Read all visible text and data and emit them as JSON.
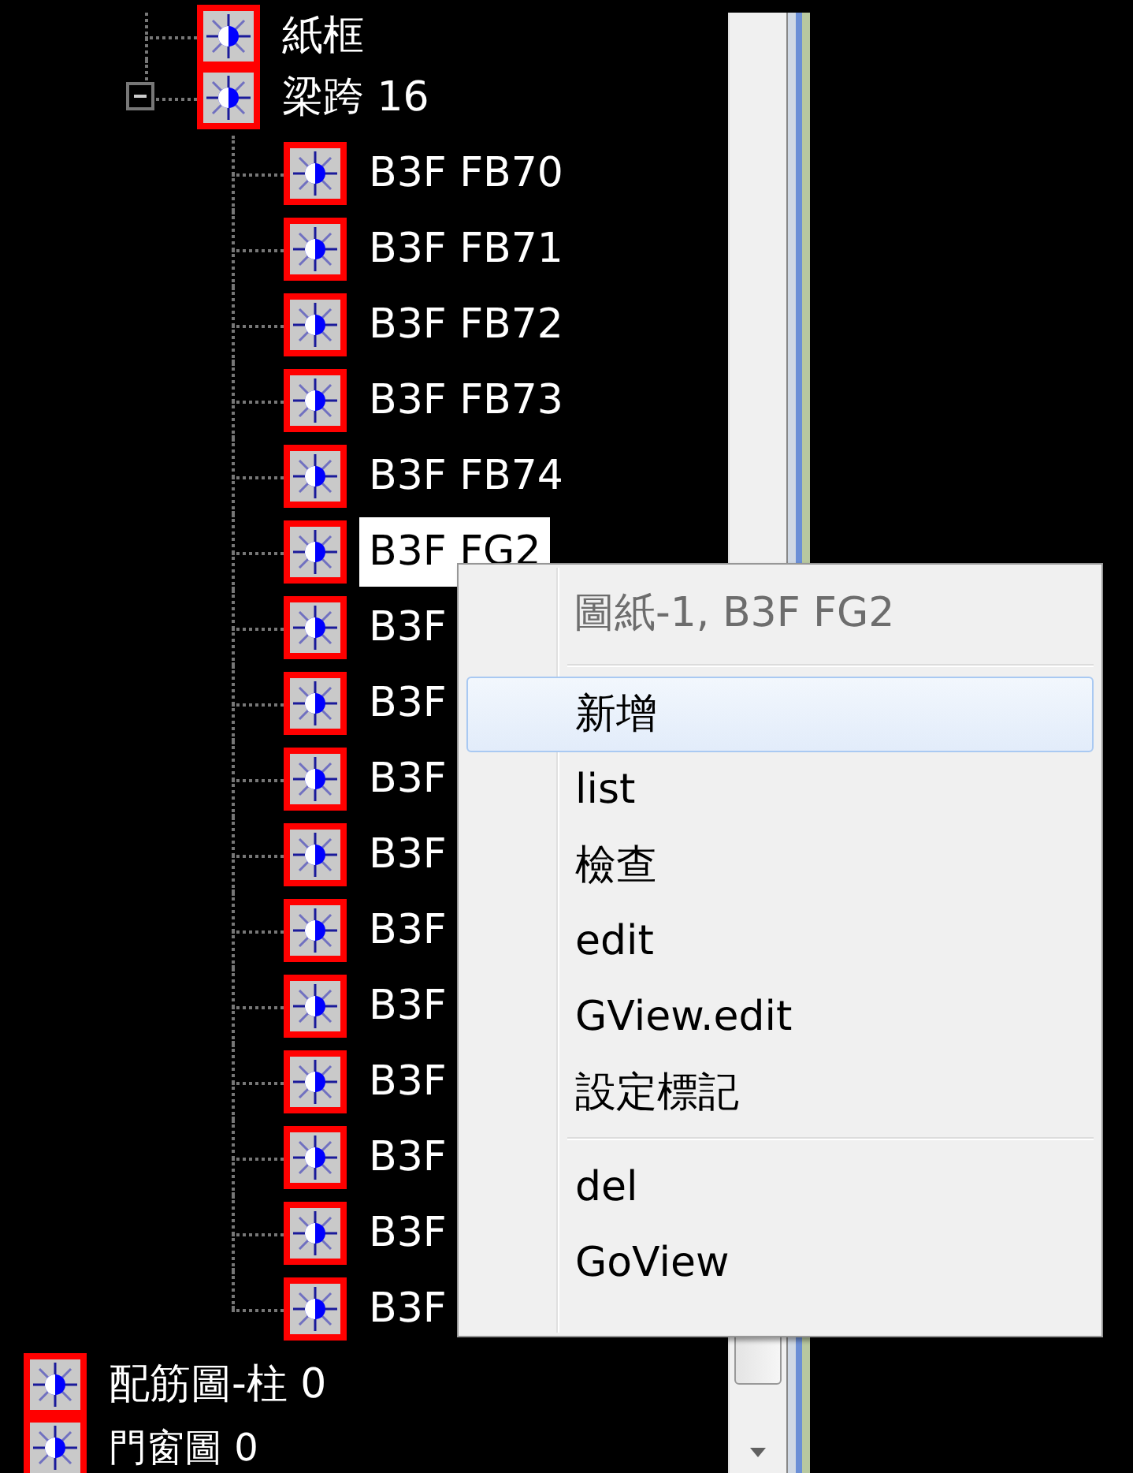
{
  "tree": {
    "nodes": [
      {
        "children": [
          {
            "children": [
              {
                "label": "紙框"
              },
              {
                "label": "梁跨 16",
                "expanded": true,
                "children": [
                  {
                    "label": "B3F FB70",
                    "selected": false
                  },
                  {
                    "label": "B3F FB71",
                    "selected": false
                  },
                  {
                    "label": "B3F FB72",
                    "selected": false
                  },
                  {
                    "label": "B3F FB73",
                    "selected": false
                  },
                  {
                    "label": "B3F FB74",
                    "selected": false
                  },
                  {
                    "label": "B3F FG2",
                    "selected": true
                  },
                  {
                    "label": "B3F",
                    "selected": false
                  },
                  {
                    "label": "B3F",
                    "selected": false
                  },
                  {
                    "label": "B3F",
                    "selected": false
                  },
                  {
                    "label": "B3F",
                    "selected": false
                  },
                  {
                    "label": "B3F",
                    "selected": false
                  },
                  {
                    "label": "B3F",
                    "selected": false
                  },
                  {
                    "label": "B3F",
                    "selected": false
                  },
                  {
                    "label": "B3F",
                    "selected": false
                  },
                  {
                    "label": "B3F",
                    "selected": false
                  },
                  {
                    "label": "B3F",
                    "selected": false
                  }
                ]
              }
            ]
          }
        ]
      },
      {
        "label": "配筋圖-柱 0"
      },
      {
        "label": "門窗圖 0"
      }
    ]
  },
  "context_menu": {
    "items": [
      {
        "kind": "header",
        "label": "圖紙-1, B3F FG2"
      },
      {
        "kind": "separator"
      },
      {
        "kind": "item",
        "label": "新增",
        "selected": true
      },
      {
        "kind": "item",
        "label": "list",
        "selected": false
      },
      {
        "kind": "item",
        "label": "檢查",
        "selected": false
      },
      {
        "kind": "item",
        "label": "edit",
        "selected": false
      },
      {
        "kind": "item",
        "label": "GView.edit",
        "selected": false
      },
      {
        "kind": "item",
        "label": "設定標記",
        "selected": false
      },
      {
        "kind": "separator"
      },
      {
        "kind": "item",
        "label": "del",
        "selected": false
      },
      {
        "kind": "item",
        "label": "GoView",
        "selected": false
      }
    ]
  }
}
